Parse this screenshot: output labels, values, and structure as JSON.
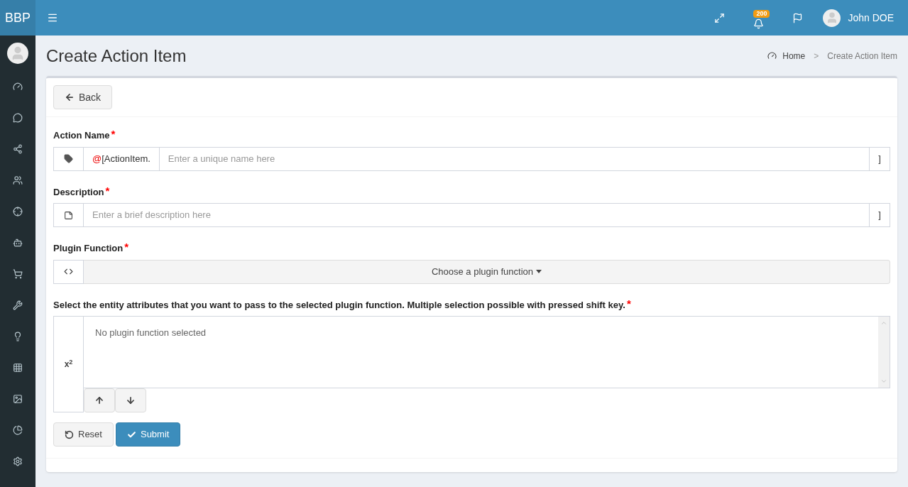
{
  "brand": "BBP",
  "header": {
    "notification_badge": "200",
    "user_name": "John DOE"
  },
  "sidebar": {
    "items": [
      {
        "selected": false
      },
      {
        "selected": false
      },
      {
        "selected": false
      },
      {
        "selected": false
      },
      {
        "selected": false
      },
      {
        "selected": false
      },
      {
        "selected": false
      },
      {
        "selected": false
      },
      {
        "selected": false
      },
      {
        "selected": false
      },
      {
        "selected": false
      },
      {
        "selected": false
      },
      {
        "selected": false
      }
    ]
  },
  "page_title": "Create Action Item",
  "breadcrumb": [
    {
      "label": "Home",
      "current": false
    },
    {
      "label": "Create Action Item",
      "current": true
    }
  ],
  "breadcrumb_separator": ">",
  "back_button": "Back",
  "form": {
    "action_name": {
      "label": "Action Name",
      "required_mark": "*",
      "prefix_symbol": "@",
      "prefix_text": "[ActionItem.",
      "placeholder": "Enter a unique name here",
      "suffix": "]"
    },
    "description": {
      "label": "Description",
      "required_mark": "*",
      "placeholder": "Enter a brief description here",
      "suffix": "]"
    },
    "plugin_function": {
      "label": "Plugin Function",
      "required_mark": "*",
      "button": "Choose a plugin function"
    },
    "attributes": {
      "label": "Select the entity attributes that you want to pass to the selected plugin function. Multiple selection possible with pressed shift key.",
      "required_mark": "*",
      "addon": "x$^{2}$",
      "empty_text": "No plugin function selected"
    }
  },
  "buttons": [
    {
      "kind": "reset",
      "label": "Reset"
    },
    {
      "kind": "submit",
      "label": "Submit"
    }
  ]
}
